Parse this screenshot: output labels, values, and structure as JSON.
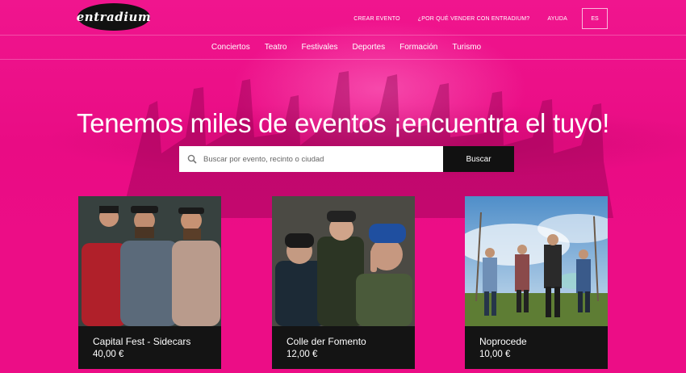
{
  "brand": {
    "logo_text": "entradium"
  },
  "topbar": {
    "links": [
      "CREAR EVENTO",
      "¿POR QUÉ VENDER CON ENTRADIUM?",
      "AYUDA"
    ],
    "lang": "ES"
  },
  "nav": {
    "categories": [
      "Conciertos",
      "Teatro",
      "Festivales",
      "Deportes",
      "Formación",
      "Turismo"
    ]
  },
  "hero": {
    "headline": "Tenemos miles de eventos ¡encuentra el tuyo!"
  },
  "search": {
    "placeholder": "Buscar por evento, recinto o ciudad",
    "button": "Buscar"
  },
  "events": [
    {
      "title": "Capital Fest - Sidecars",
      "price": "40,00 €"
    },
    {
      "title": "Colle der Fomento",
      "price": "12,00 €"
    },
    {
      "title": "Noprocede",
      "price": "10,00 €"
    }
  ],
  "colors": {
    "brand_pink": "#ec0d86",
    "dark": "#141414",
    "white": "#ffffff"
  }
}
